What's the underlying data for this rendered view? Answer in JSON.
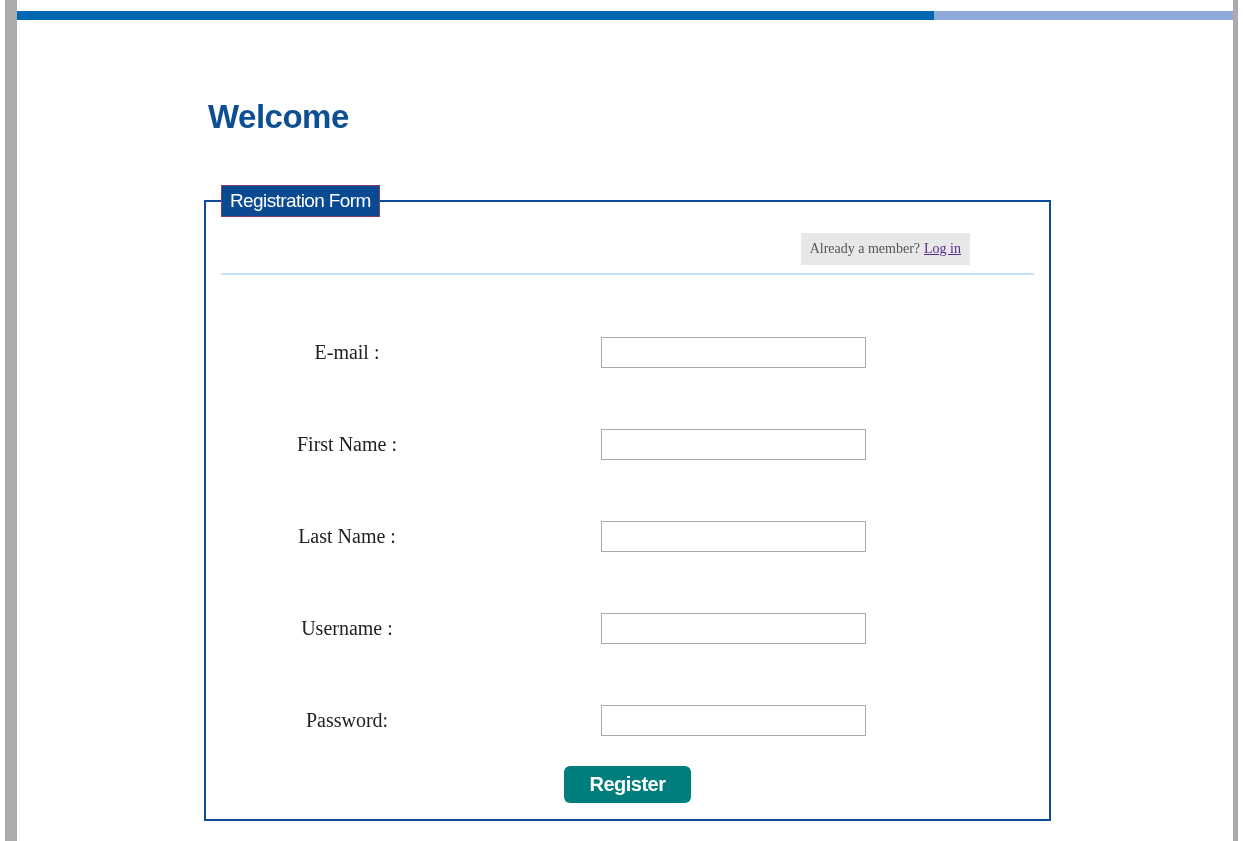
{
  "top_bar": {
    "level": 0.754
  },
  "heading": "Welcome",
  "form": {
    "legend": "Registration Form",
    "login_prompt": "Already a member?",
    "login_link": "Log in",
    "fields": [
      {
        "label": "E-mail :"
      },
      {
        "label": "First Name :"
      },
      {
        "label": "Last Name :"
      },
      {
        "label": "Username :"
      },
      {
        "label": "Password:"
      }
    ],
    "submit": "Register"
  }
}
